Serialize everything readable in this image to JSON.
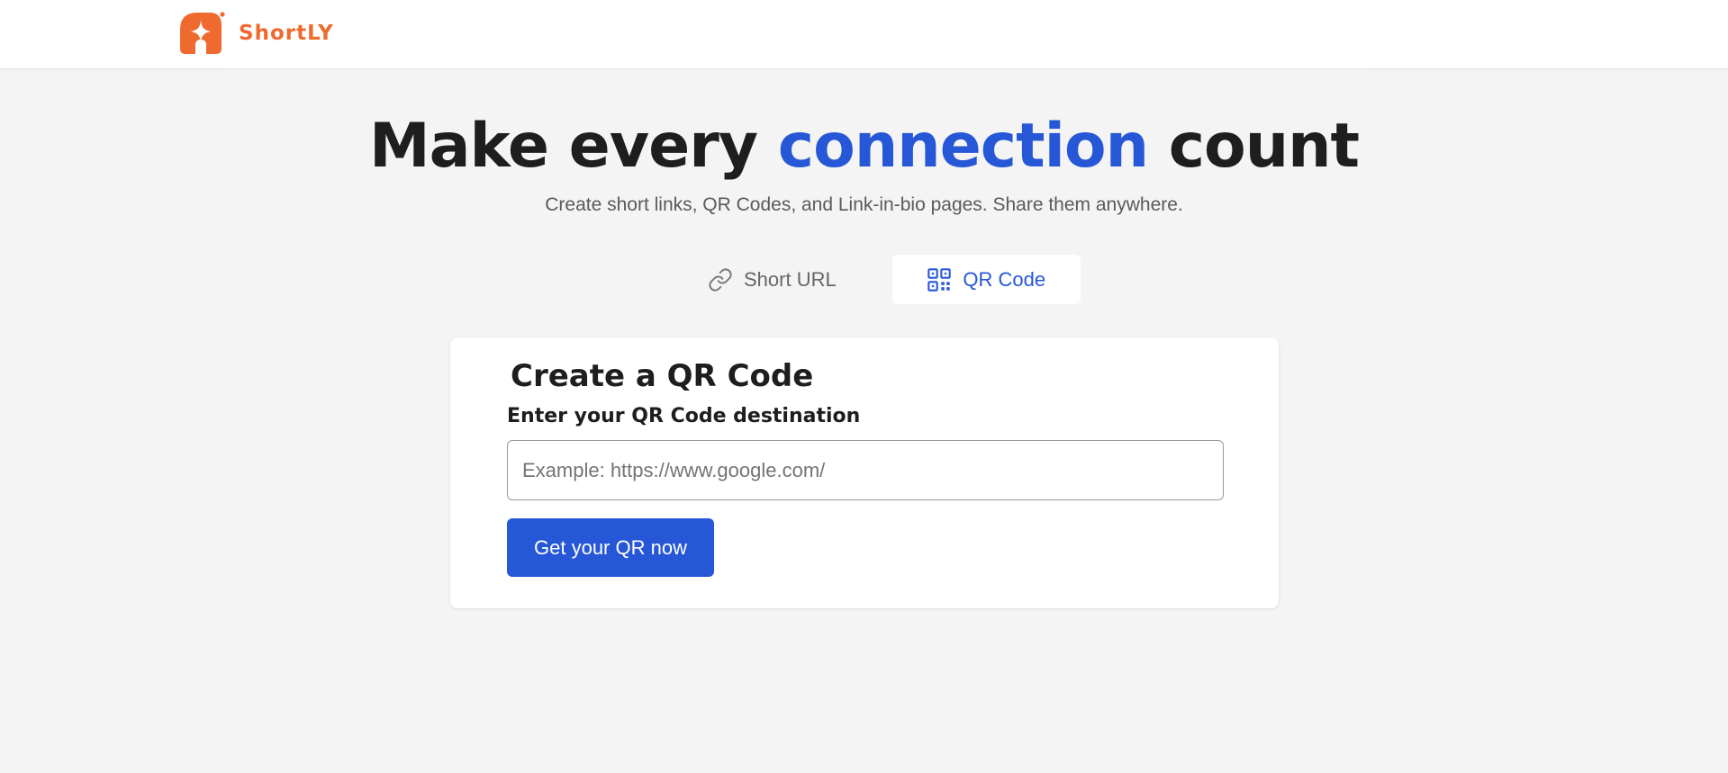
{
  "header": {
    "brand_name": "ShortLY",
    "logo_icon": "star-sparkle-logo",
    "brand_color": "#ef6a2e"
  },
  "hero": {
    "headline_before": "Make every",
    "headline_accent": "connection",
    "headline_after": "count",
    "subtitle": "Create short links, QR Codes, and Link-in-bio pages. Share them anywhere.",
    "accent_color": "#2657d6"
  },
  "tabs": [
    {
      "label": "Short URL",
      "icon": "link-icon",
      "active": false
    },
    {
      "label": "QR Code",
      "icon": "qr-code-icon",
      "active": true
    }
  ],
  "form": {
    "title": "Create a QR Code",
    "field_label": "Enter your QR Code destination",
    "input_placeholder": "Example: https://www.google.com/",
    "input_value": "",
    "submit_label": "Get your QR now"
  }
}
